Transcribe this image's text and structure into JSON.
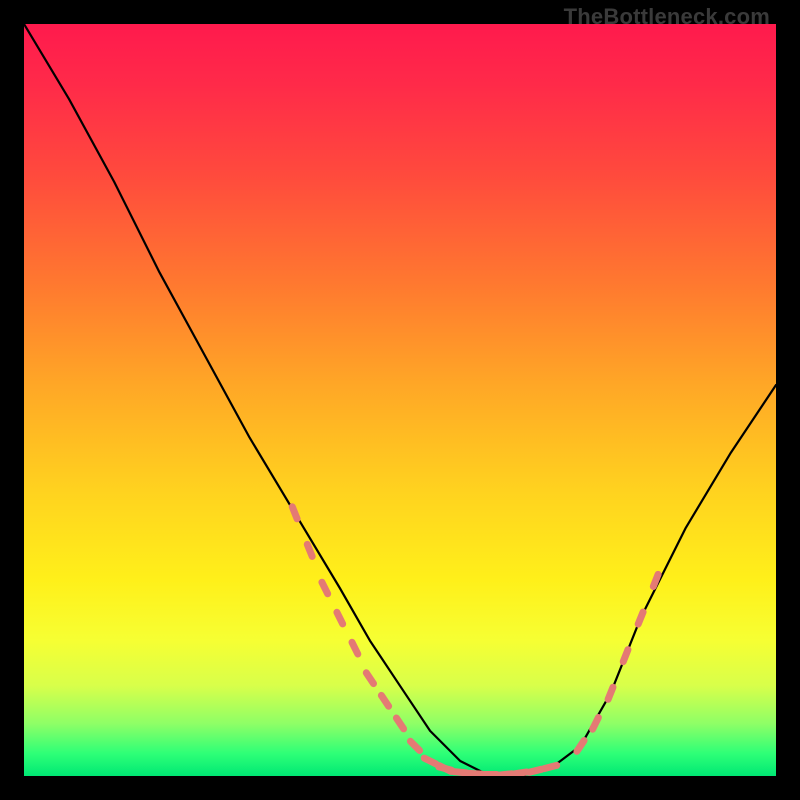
{
  "watermark": "TheBottleneck.com",
  "chart_data": {
    "type": "line",
    "title": "",
    "xlabel": "",
    "ylabel": "",
    "xlim": [
      0,
      100
    ],
    "ylim": [
      0,
      100
    ],
    "series": [
      {
        "name": "curve",
        "color": "#000000",
        "x": [
          0,
          6,
          12,
          18,
          24,
          30,
          36,
          42,
          46,
          50,
          54,
          58,
          62,
          66,
          70,
          74,
          78,
          82,
          88,
          94,
          100
        ],
        "values": [
          100,
          90,
          79,
          67,
          56,
          45,
          35,
          25,
          18,
          12,
          6,
          2,
          0,
          0,
          1,
          4,
          11,
          21,
          33,
          43,
          52
        ]
      }
    ],
    "markers": {
      "name": "dotted-segments",
      "color": "#e47a74",
      "segments": [
        {
          "x": [
            36,
            38,
            40,
            42,
            44,
            46,
            48,
            50,
            52,
            54,
            56
          ],
          "y": [
            35,
            30,
            25,
            21,
            17,
            13,
            10,
            7,
            4,
            2,
            1
          ]
        },
        {
          "x": [
            56,
            58,
            60,
            62,
            64,
            66,
            68,
            70
          ],
          "y": [
            1,
            0.5,
            0.3,
            0.2,
            0.2,
            0.4,
            0.7,
            1.2
          ]
        },
        {
          "x": [
            74,
            76,
            78,
            80,
            82,
            84
          ],
          "y": [
            4,
            7,
            11,
            16,
            21,
            26
          ]
        }
      ]
    },
    "background_gradient": {
      "stops": [
        {
          "pos": 0,
          "color": "#ff1a4d"
        },
        {
          "pos": 20,
          "color": "#ff4a3d"
        },
        {
          "pos": 48,
          "color": "#ffa726"
        },
        {
          "pos": 74,
          "color": "#fff01a"
        },
        {
          "pos": 93,
          "color": "#8fff66"
        },
        {
          "pos": 100,
          "color": "#00e874"
        }
      ]
    }
  }
}
